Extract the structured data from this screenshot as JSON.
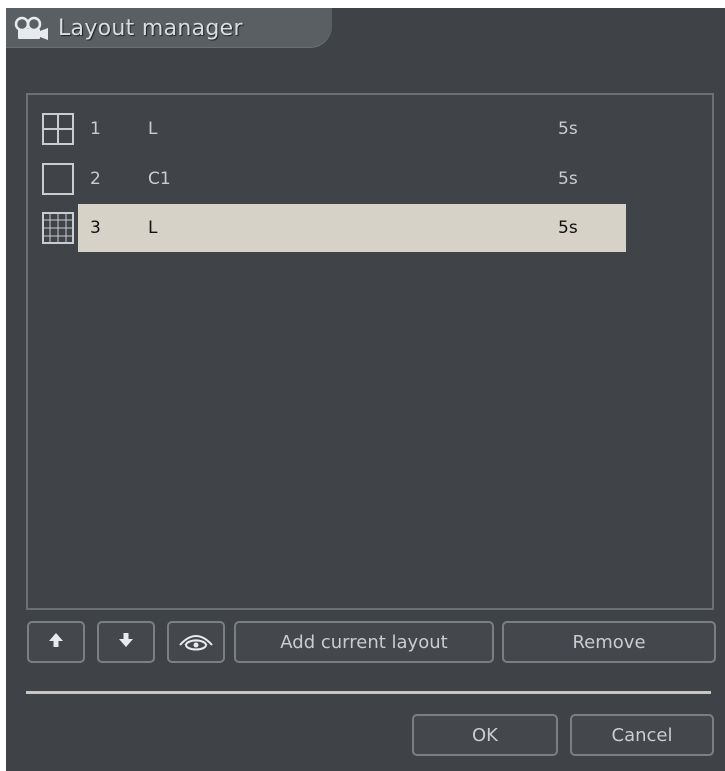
{
  "window": {
    "title": "Layout manager"
  },
  "layouts": [
    {
      "number": "1",
      "name": "L",
      "duration": "5s",
      "icon": "grid-2x2-icon",
      "selected": false
    },
    {
      "number": "2",
      "name": "C1",
      "duration": "5s",
      "icon": "single-view-icon",
      "selected": false
    },
    {
      "number": "3",
      "name": "L",
      "duration": "5s",
      "icon": "grid-multi-icon",
      "selected": true
    }
  ],
  "toolbar": {
    "move_up_icon": "arrow-up-icon",
    "move_down_icon": "arrow-down-icon",
    "preview_icon": "eye-icon",
    "add_label": "Add current layout",
    "remove_label": "Remove"
  },
  "footer": {
    "ok_label": "OK",
    "cancel_label": "Cancel"
  },
  "colors": {
    "background": "#3f4347",
    "selection": "#d6d2c8",
    "text": "#c9cdd2"
  }
}
